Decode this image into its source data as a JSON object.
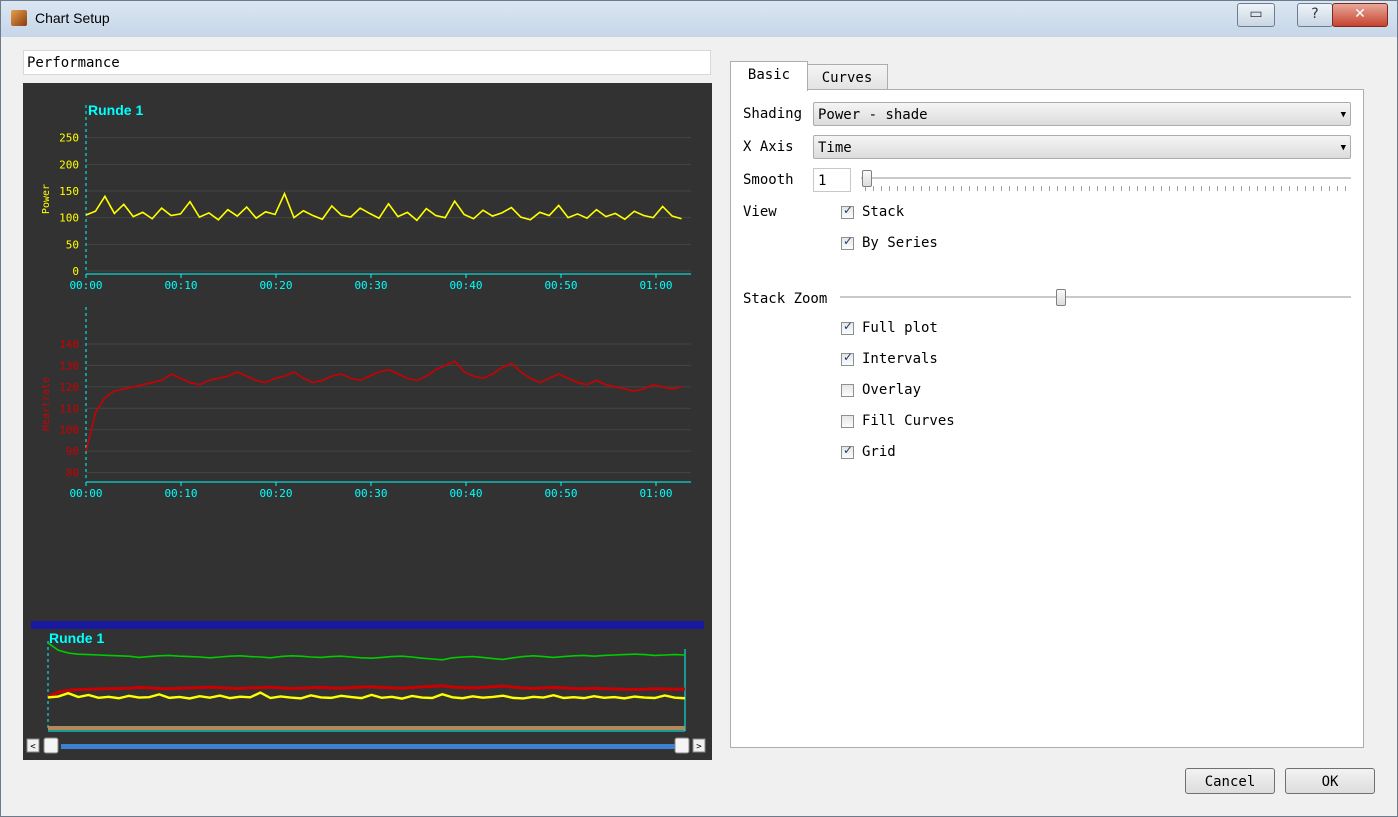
{
  "window": {
    "title": "Chart Setup",
    "help_label": "?",
    "close_label": "✕",
    "icon": "app-icon"
  },
  "chart_name": "Performance",
  "colors": {
    "plot_bg": "#323232",
    "axis": "#00ffff",
    "power": "#ffff00",
    "heartrate": "#cc0000",
    "speed": "#00cc00",
    "overview_bar": "#1a1aa0"
  },
  "tabs": [
    {
      "label": "Basic"
    },
    {
      "label": "Curves"
    }
  ],
  "basic": {
    "shading_label": "Shading",
    "shading_value": "Power - shade",
    "xaxis_label": "X Axis",
    "xaxis_value": "Time",
    "smooth_label": "Smooth",
    "smooth_value": "1",
    "view_label": "View",
    "stack_label": "Stack",
    "by_series_label": "By Series",
    "stack_zoom_label": "Stack Zoom",
    "full_plot_label": "Full plot",
    "intervals_label": "Intervals",
    "overlay_label": "Overlay",
    "fill_curves_label": "Fill Curves",
    "grid_label": "Grid",
    "checked": {
      "stack": true,
      "by_series": true,
      "full_plot": true,
      "intervals": true,
      "overlay": false,
      "fill_curves": false,
      "grid": true
    },
    "smooth_slider_level": 0.0,
    "stack_zoom_level": 0.43
  },
  "buttons": {
    "cancel": "Cancel",
    "ok": "OK"
  },
  "overview": {
    "label": "Runde 1",
    "left_arrow": "<",
    "right_arrow": ">"
  },
  "chart_data": [
    {
      "type": "line",
      "interval_label": "Runde 1",
      "ylabel": "Power",
      "yticks": [
        "250",
        "200",
        "150",
        "100",
        "50",
        "0"
      ],
      "ylim": [
        0,
        270
      ],
      "xticks": [
        "00:00",
        "00:10",
        "00:20",
        "00:30",
        "00:40",
        "00:50",
        "01:00"
      ],
      "xlim": [
        0,
        64
      ],
      "series": [
        {
          "values": [
            105,
            112,
            140,
            108,
            125,
            102,
            110,
            98,
            118,
            104,
            107,
            130,
            101,
            109,
            96,
            115,
            103,
            120,
            99,
            111,
            106,
            145,
            100,
            113,
            104,
            97,
            122,
            105,
            101,
            118,
            108,
            99,
            126,
            102,
            110,
            95,
            117,
            104,
            100,
            131,
            106,
            98,
            114,
            103,
            109,
            119,
            101,
            96,
            110,
            104,
            123,
            100,
            107,
            99,
            115,
            102,
            108,
            97,
            112,
            104,
            100,
            121,
            103,
            98
          ]
        }
      ]
    },
    {
      "type": "line",
      "ylabel": "Heartrate",
      "yticks": [
        "140",
        "130",
        "120",
        "110",
        "100",
        "90",
        "80"
      ],
      "ylim": [
        77,
        147
      ],
      "xticks": [
        "00:00",
        "00:10",
        "00:20",
        "00:30",
        "00:40",
        "00:50",
        "01:00"
      ],
      "xlim": [
        0,
        64
      ],
      "series": [
        {
          "values": [
            90,
            108,
            115,
            118,
            119,
            120,
            121,
            122,
            123,
            126,
            124,
            122,
            121,
            123,
            124,
            125,
            127,
            125,
            123,
            122,
            124,
            125,
            127,
            124,
            122,
            123,
            125,
            126,
            124,
            123,
            125,
            127,
            128,
            126,
            124,
            123,
            125,
            128,
            130,
            132,
            127,
            125,
            124,
            126,
            129,
            131,
            127,
            124,
            122,
            124,
            126,
            124,
            122,
            121,
            123,
            121,
            120,
            119,
            118,
            119,
            121,
            120,
            119,
            120
          ]
        }
      ]
    }
  ]
}
